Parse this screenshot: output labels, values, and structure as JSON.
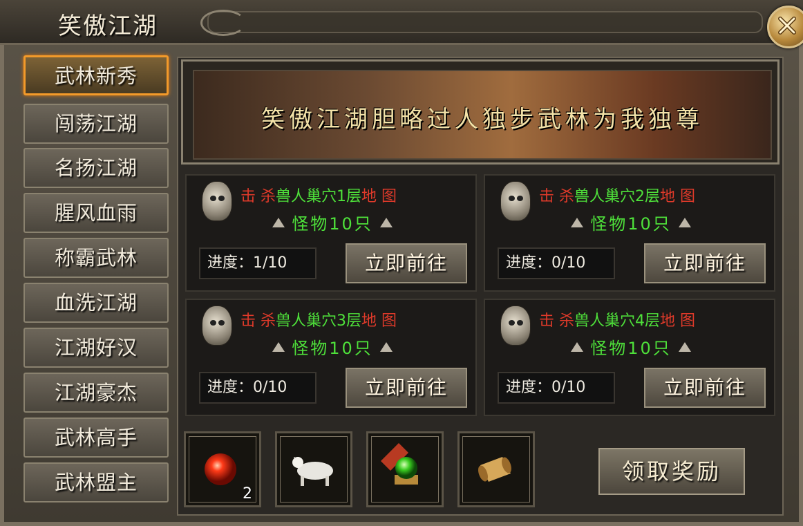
{
  "window": {
    "title": "笑傲江湖"
  },
  "sidebar": {
    "items": [
      {
        "label": "武林新秀",
        "active": true
      },
      {
        "label": "闯荡江湖"
      },
      {
        "label": "名扬江湖"
      },
      {
        "label": "腥风血雨"
      },
      {
        "label": "称霸武林"
      },
      {
        "label": "血洗江湖"
      },
      {
        "label": "江湖好汉"
      },
      {
        "label": "江湖豪杰"
      },
      {
        "label": "武林高手"
      },
      {
        "label": "武林盟主"
      }
    ]
  },
  "banner": {
    "text": "笑傲江湖胆略过人独步武林为我独尊"
  },
  "tasks": [
    {
      "prefix": "击 杀",
      "target": "兽人巢穴1层",
      "suffix": "地 图",
      "monsters": "怪物10只",
      "progress": "进度：1/10",
      "button": "立即前往"
    },
    {
      "prefix": "击 杀",
      "target": "兽人巢穴2层",
      "suffix": "地 图",
      "monsters": "怪物10只",
      "progress": "进度：0/10",
      "button": "立即前往"
    },
    {
      "prefix": "击 杀",
      "target": "兽人巢穴3层",
      "suffix": "地 图",
      "monsters": "怪物10只",
      "progress": "进度：0/10",
      "button": "立即前往"
    },
    {
      "prefix": "击 杀",
      "target": "兽人巢穴4层",
      "suffix": "地 图",
      "monsters": "怪物10只",
      "progress": "进度：0/10",
      "button": "立即前往"
    }
  ],
  "rewards": {
    "items": [
      {
        "icon": "red-orb-icon",
        "count": "2"
      },
      {
        "icon": "white-horse-icon",
        "count": ""
      },
      {
        "icon": "green-jade-icon",
        "count": ""
      },
      {
        "icon": "scroll-icon",
        "count": ""
      }
    ],
    "claim_label": "领取奖励"
  },
  "colors": {
    "accent": "#f39a2a",
    "red_text": "#e03a2a",
    "green_text": "#4ee03a"
  }
}
